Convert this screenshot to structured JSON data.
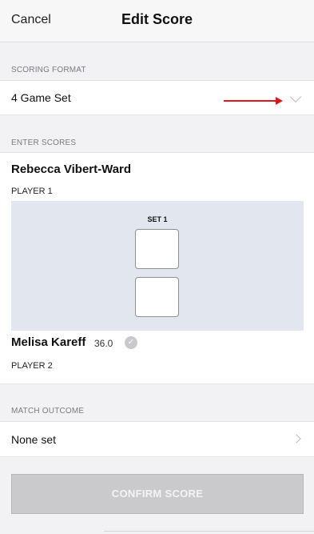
{
  "header": {
    "cancel_label": "Cancel",
    "title": "Edit Score"
  },
  "scoring_format": {
    "section_label": "SCORING FORMAT",
    "value": "4 Game Set"
  },
  "enter_scores": {
    "section_label": "ENTER SCORES",
    "player1": {
      "name": "Rebecca Vibert-Ward",
      "label": "PLAYER 1"
    },
    "set_label": "SET 1",
    "player2": {
      "name": "Melisa Kareff",
      "rating": "36.0",
      "label": "PLAYER 2"
    }
  },
  "match_outcome": {
    "section_label": "MATCH OUTCOME",
    "value": "None set"
  },
  "confirm_label": "CONFIRM SCORE",
  "colors": {
    "annotation_arrow": "#e0161b",
    "score_panel": "#e2e6ee",
    "disabled_button": "#cacacd"
  },
  "icons": [
    "chevron-down-icon",
    "chevron-right-icon",
    "verified-badge-icon"
  ]
}
